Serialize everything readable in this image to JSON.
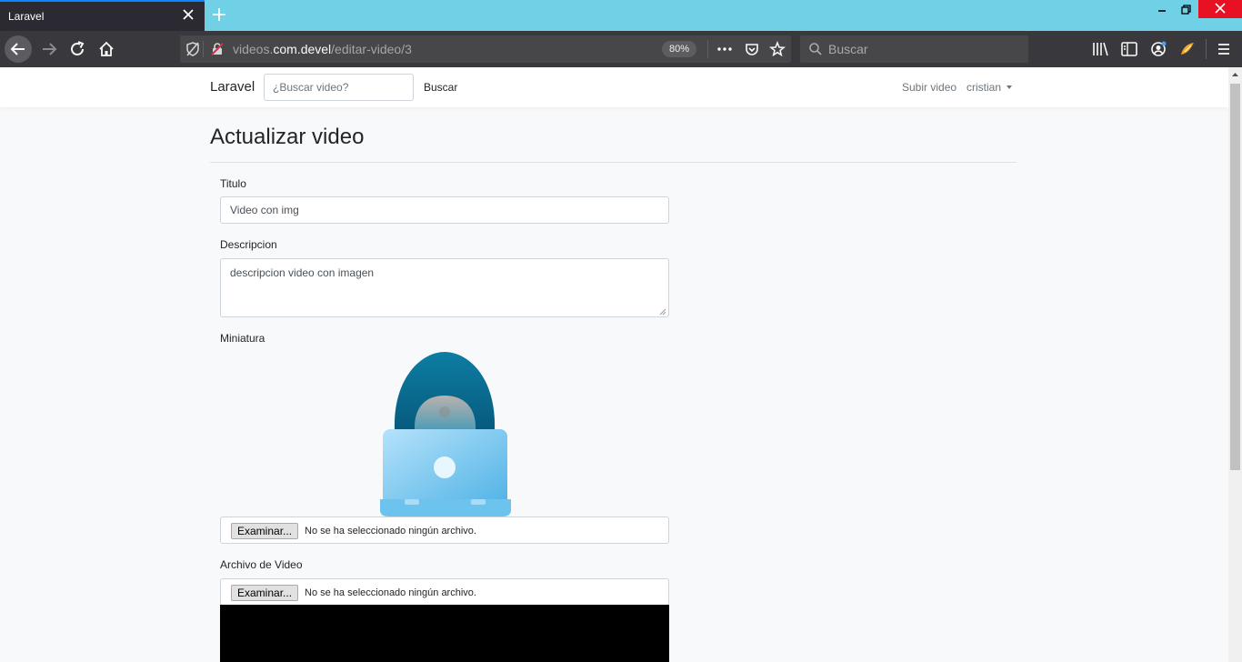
{
  "browser": {
    "tab_title": "Laravel",
    "url_prefix": "videos.",
    "url_domain": "com.devel",
    "url_path": "/editar-video/3",
    "zoom": "80%",
    "search_placeholder": "Buscar",
    "colors": {
      "tabbar": "#6fd0e6",
      "toolbar": "#38383d",
      "tab_active": "#2b2a33"
    }
  },
  "navbar": {
    "brand": "Laravel",
    "search_placeholder": "¿Buscar video?",
    "search_button": "Buscar",
    "upload_link": "Subir video",
    "user_menu": "cristian"
  },
  "form": {
    "heading": "Actualizar video",
    "title_label": "Titulo",
    "title_value": "Video con img",
    "description_label": "Descripcion",
    "description_value": "descripcion video con imagen",
    "thumbnail_label": "Miniatura",
    "thumbnail_icon": "hooded-user-laptop-icon",
    "thumbnail_button": "Examinar...",
    "thumbnail_status": "No se ha seleccionado ningún archivo.",
    "video_label": "Archivo de Video",
    "video_button": "Examinar...",
    "video_status": "No se ha seleccionado ningún archivo."
  }
}
